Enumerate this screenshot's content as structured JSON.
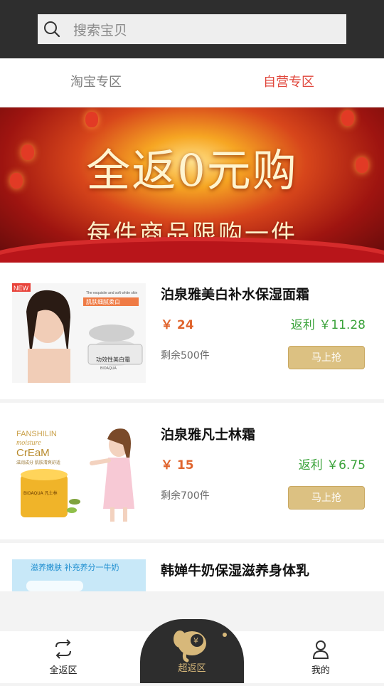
{
  "search": {
    "placeholder": "搜索宝贝",
    "icon": "search-icon"
  },
  "tabs": [
    {
      "label": "淘宝专区",
      "active": false
    },
    {
      "label": "自营专区",
      "active": true
    }
  ],
  "banner": {
    "title": "全返0元购",
    "subtitle": "每件商品限购一件"
  },
  "products": [
    {
      "name": "泊泉雅美白补水保湿面霜",
      "price": "￥ 24",
      "rebate": "返利 ￥11.28",
      "stock": "剩余500件",
      "buy_label": "马上抢",
      "image_text": {
        "badge": "NEW",
        "headline": "The exquisite and soft white skin",
        "title": "肌肤细腻柔白",
        "jar": "功效性美白霜",
        "brand": "BIOAQUA"
      }
    },
    {
      "name": "泊泉雅凡士林霜",
      "price": "￥ 15",
      "rebate": "返利 ￥6.75",
      "stock": "剩余700件",
      "buy_label": "马上抢",
      "image_text": {
        "line1": "FANSHILIN",
        "line2": "moisture",
        "line3": "CrEaM",
        "line4": "滋润成分 肌肤清爽舒适",
        "jar": "BIOAQUA 凡士林"
      }
    },
    {
      "name": "韩婵牛奶保湿滋养身体乳",
      "price": "",
      "rebate": "",
      "stock": "",
      "buy_label": "",
      "image_text": {
        "headline": "滋养嫩肤 补充养分一牛奶"
      }
    }
  ],
  "tabbar": {
    "left": "全返区",
    "center": "超返区",
    "right": "我的"
  },
  "colors": {
    "accent_red": "#e0463b",
    "price_orange": "#e0652e",
    "rebate_green": "#3aa23a",
    "button_gold": "#dcc182",
    "dark": "#2e2e2e"
  }
}
